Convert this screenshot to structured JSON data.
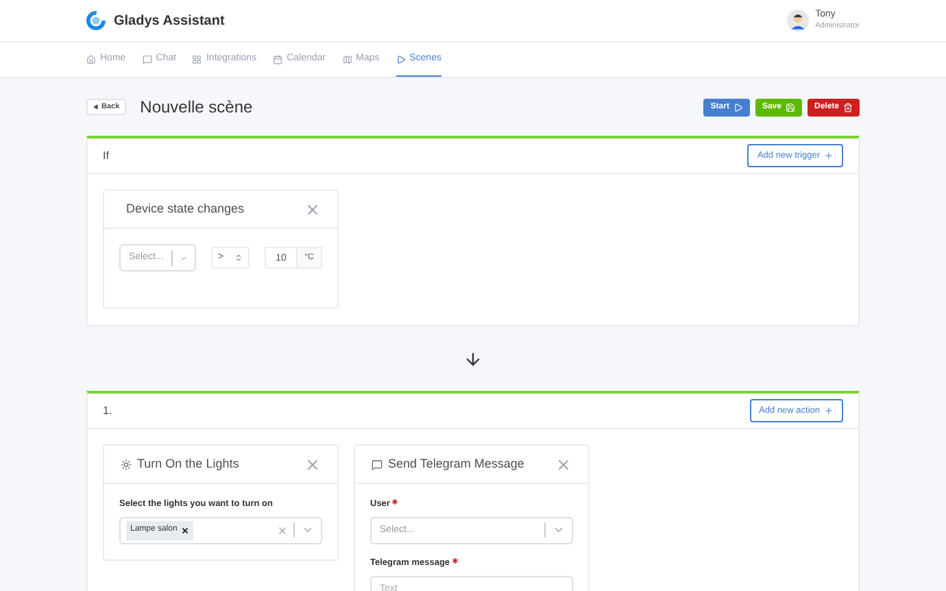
{
  "header": {
    "app_name": "Gladys Assistant",
    "user": {
      "name": "Tony",
      "role": "Administrator"
    }
  },
  "nav": [
    {
      "label": "Home",
      "selected": false
    },
    {
      "label": "Chat",
      "selected": false
    },
    {
      "label": "Integrations",
      "selected": false
    },
    {
      "label": "Calendar",
      "selected": false
    },
    {
      "label": "Maps",
      "selected": false
    },
    {
      "label": "Scenes",
      "selected": true
    }
  ],
  "page": {
    "back_button": "Back",
    "title": "Nouvelle scène",
    "actions": [
      {
        "label": "Start",
        "kind": "start"
      },
      {
        "label": "Save",
        "kind": "save"
      },
      {
        "label": "Delete",
        "kind": "delete"
      }
    ]
  },
  "trigger_section": {
    "label": "If",
    "add_button": "Add new trigger",
    "cards": [
      {
        "title": "Device state changes",
        "device_placeholder": "Select...",
        "operator": ">",
        "value": "10",
        "unit": "°C"
      }
    ]
  },
  "action_groups": [
    {
      "index": "1.",
      "add_button": "Add new action",
      "actions": [
        {
          "kind": "lights",
          "title": "Turn On the Lights",
          "field_label": "Select the lights you want to turn on",
          "tags": [
            "Lampe salon"
          ]
        },
        {
          "kind": "telegram",
          "title": "Send Telegram Message",
          "fields": [
            {
              "kind": "select",
              "label": "User",
              "required": true,
              "placeholder": "Select..."
            },
            {
              "kind": "text",
              "label": "Telegram message",
              "required": true,
              "placeholder": "Text"
            }
          ]
        }
      ]
    }
  ]
}
